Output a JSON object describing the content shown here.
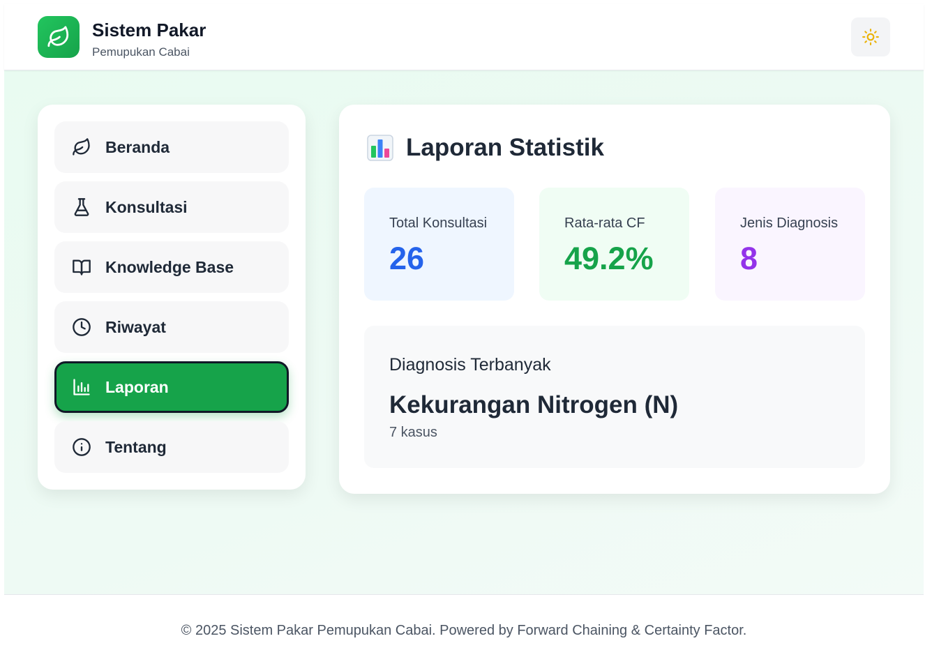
{
  "header": {
    "title": "Sistem Pakar",
    "subtitle": "Pemupukan Cabai",
    "logo_icon": "leaf-icon",
    "theme_toggle_icon": "sun-icon"
  },
  "sidebar": {
    "items": [
      {
        "label": "Beranda",
        "icon": "leaf-icon",
        "active": false
      },
      {
        "label": "Konsultasi",
        "icon": "flask-icon",
        "active": false
      },
      {
        "label": "Knowledge Base",
        "icon": "book-open-icon",
        "active": false
      },
      {
        "label": "Riwayat",
        "icon": "clock-icon",
        "active": false
      },
      {
        "label": "Laporan",
        "icon": "bar-chart-icon",
        "active": true
      },
      {
        "label": "Tentang",
        "icon": "info-icon",
        "active": false
      }
    ]
  },
  "report": {
    "title": "Laporan Statistik",
    "title_icon": "bar-chart-emoji-icon",
    "stats": [
      {
        "label": "Total Konsultasi",
        "value": "26",
        "color": "#2563eb",
        "bg": "#eff6ff"
      },
      {
        "label": "Rata-rata CF",
        "value": "49.2%",
        "color": "#16a34a",
        "bg": "#f0fdf4"
      },
      {
        "label": "Jenis Diagnosis",
        "value": "8",
        "color": "#9333ea",
        "bg": "#faf5ff"
      }
    ],
    "top_diagnosis": {
      "label": "Diagnosis Terbanyak",
      "name": "Kekurangan Nitrogen (N)",
      "count": "7 kasus"
    }
  },
  "footer": {
    "copyright": "© 2025 Sistem Pakar Pemupukan Cabai. Powered by Forward Chaining & Certainty Factor."
  },
  "colors": {
    "accent": "#16a34a",
    "active_border": "#111827",
    "sun": "#eab308"
  }
}
